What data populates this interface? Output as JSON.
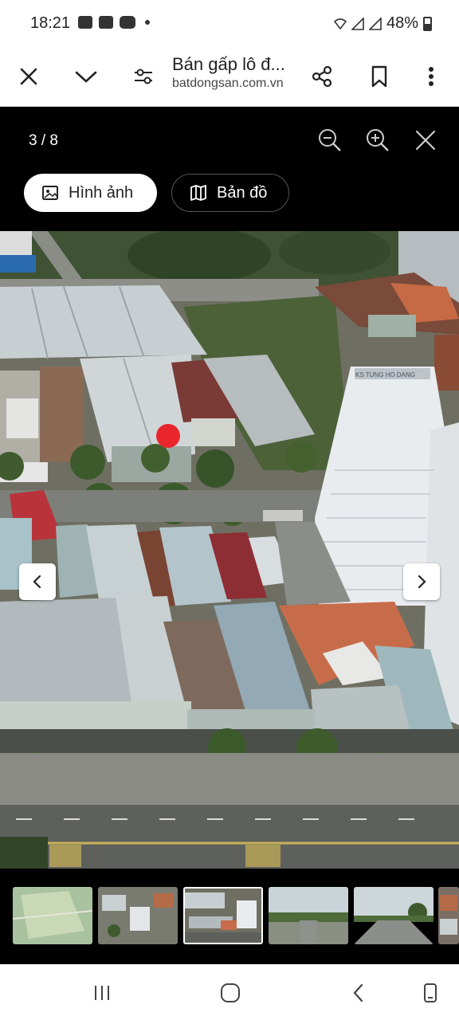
{
  "status_bar": {
    "time": "18:21",
    "battery": "48%",
    "left_icons": [
      "image-icon",
      "news-icon",
      "youtube-icon",
      "dot-icon"
    ],
    "right_icons": [
      "wifi-icon",
      "signal-icon",
      "signal-icon",
      "battery-icon"
    ]
  },
  "toolbar": {
    "title": "Bán gấp lô đ...",
    "domain": "batdongsan.com.vn",
    "icons": [
      "close-icon",
      "chevron-down-icon",
      "tune-icon",
      "share-icon",
      "bookmark-icon",
      "more-vert-icon"
    ]
  },
  "viewer": {
    "counter": "3 / 8",
    "tabs": [
      {
        "label": "Hình ảnh",
        "icon": "image-icon",
        "active": true
      },
      {
        "label": "Bản đồ",
        "icon": "map-icon",
        "active": false
      }
    ]
  },
  "photo": {
    "sign_text": "KS TUNG HO DANG",
    "marker_color": "#e8262c"
  },
  "thumbnails": {
    "count": 6,
    "selected_index": 2
  },
  "system_nav": {
    "icons": [
      "recent-apps-icon",
      "home-icon",
      "back-icon",
      "rotate-icon"
    ]
  }
}
